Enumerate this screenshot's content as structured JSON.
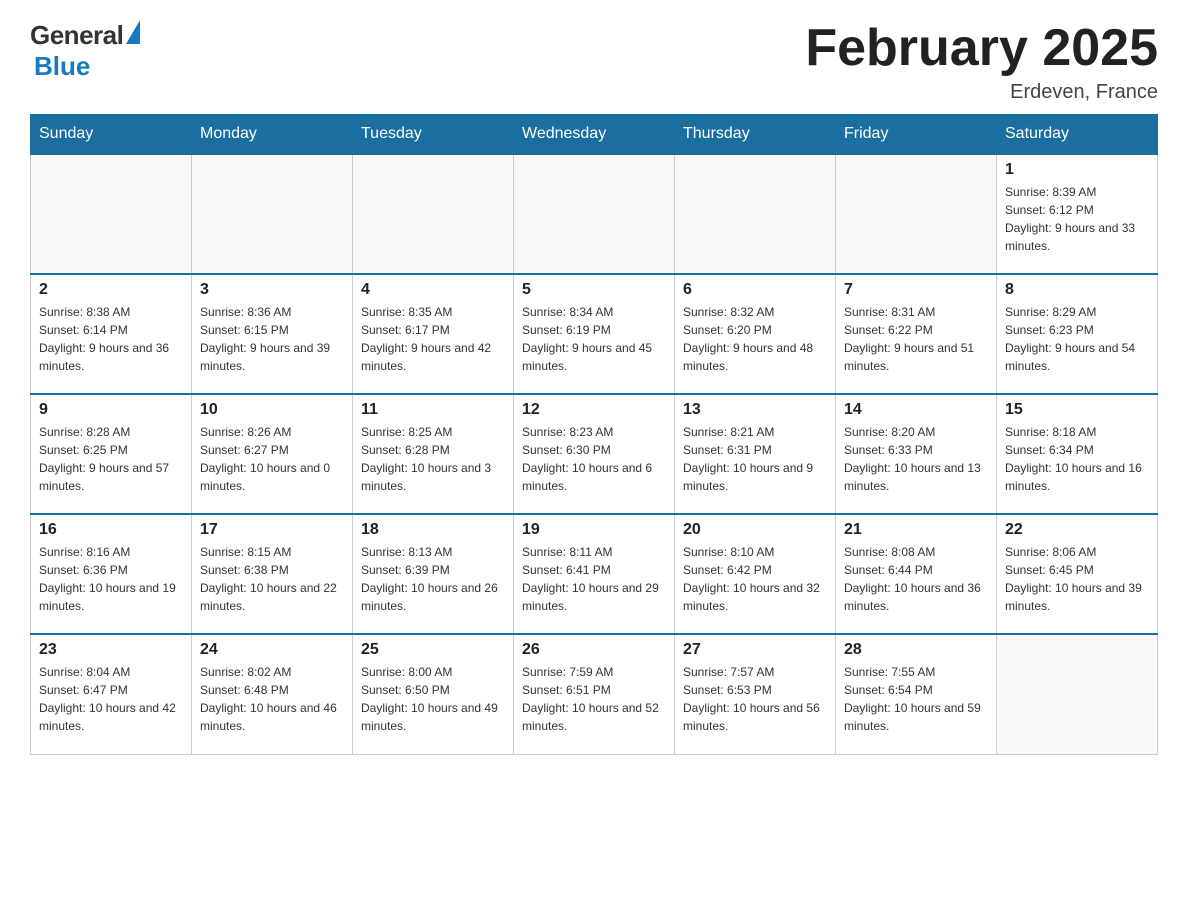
{
  "header": {
    "title": "February 2025",
    "location": "Erdeven, France"
  },
  "logo": {
    "general": "General",
    "blue": "Blue"
  },
  "weekdays": [
    "Sunday",
    "Monday",
    "Tuesday",
    "Wednesday",
    "Thursday",
    "Friday",
    "Saturday"
  ],
  "weeks": [
    [
      {
        "day": "",
        "info": ""
      },
      {
        "day": "",
        "info": ""
      },
      {
        "day": "",
        "info": ""
      },
      {
        "day": "",
        "info": ""
      },
      {
        "day": "",
        "info": ""
      },
      {
        "day": "",
        "info": ""
      },
      {
        "day": "1",
        "info": "Sunrise: 8:39 AM\nSunset: 6:12 PM\nDaylight: 9 hours and 33 minutes."
      }
    ],
    [
      {
        "day": "2",
        "info": "Sunrise: 8:38 AM\nSunset: 6:14 PM\nDaylight: 9 hours and 36 minutes."
      },
      {
        "day": "3",
        "info": "Sunrise: 8:36 AM\nSunset: 6:15 PM\nDaylight: 9 hours and 39 minutes."
      },
      {
        "day": "4",
        "info": "Sunrise: 8:35 AM\nSunset: 6:17 PM\nDaylight: 9 hours and 42 minutes."
      },
      {
        "day": "5",
        "info": "Sunrise: 8:34 AM\nSunset: 6:19 PM\nDaylight: 9 hours and 45 minutes."
      },
      {
        "day": "6",
        "info": "Sunrise: 8:32 AM\nSunset: 6:20 PM\nDaylight: 9 hours and 48 minutes."
      },
      {
        "day": "7",
        "info": "Sunrise: 8:31 AM\nSunset: 6:22 PM\nDaylight: 9 hours and 51 minutes."
      },
      {
        "day": "8",
        "info": "Sunrise: 8:29 AM\nSunset: 6:23 PM\nDaylight: 9 hours and 54 minutes."
      }
    ],
    [
      {
        "day": "9",
        "info": "Sunrise: 8:28 AM\nSunset: 6:25 PM\nDaylight: 9 hours and 57 minutes."
      },
      {
        "day": "10",
        "info": "Sunrise: 8:26 AM\nSunset: 6:27 PM\nDaylight: 10 hours and 0 minutes."
      },
      {
        "day": "11",
        "info": "Sunrise: 8:25 AM\nSunset: 6:28 PM\nDaylight: 10 hours and 3 minutes."
      },
      {
        "day": "12",
        "info": "Sunrise: 8:23 AM\nSunset: 6:30 PM\nDaylight: 10 hours and 6 minutes."
      },
      {
        "day": "13",
        "info": "Sunrise: 8:21 AM\nSunset: 6:31 PM\nDaylight: 10 hours and 9 minutes."
      },
      {
        "day": "14",
        "info": "Sunrise: 8:20 AM\nSunset: 6:33 PM\nDaylight: 10 hours and 13 minutes."
      },
      {
        "day": "15",
        "info": "Sunrise: 8:18 AM\nSunset: 6:34 PM\nDaylight: 10 hours and 16 minutes."
      }
    ],
    [
      {
        "day": "16",
        "info": "Sunrise: 8:16 AM\nSunset: 6:36 PM\nDaylight: 10 hours and 19 minutes."
      },
      {
        "day": "17",
        "info": "Sunrise: 8:15 AM\nSunset: 6:38 PM\nDaylight: 10 hours and 22 minutes."
      },
      {
        "day": "18",
        "info": "Sunrise: 8:13 AM\nSunset: 6:39 PM\nDaylight: 10 hours and 26 minutes."
      },
      {
        "day": "19",
        "info": "Sunrise: 8:11 AM\nSunset: 6:41 PM\nDaylight: 10 hours and 29 minutes."
      },
      {
        "day": "20",
        "info": "Sunrise: 8:10 AM\nSunset: 6:42 PM\nDaylight: 10 hours and 32 minutes."
      },
      {
        "day": "21",
        "info": "Sunrise: 8:08 AM\nSunset: 6:44 PM\nDaylight: 10 hours and 36 minutes."
      },
      {
        "day": "22",
        "info": "Sunrise: 8:06 AM\nSunset: 6:45 PM\nDaylight: 10 hours and 39 minutes."
      }
    ],
    [
      {
        "day": "23",
        "info": "Sunrise: 8:04 AM\nSunset: 6:47 PM\nDaylight: 10 hours and 42 minutes."
      },
      {
        "day": "24",
        "info": "Sunrise: 8:02 AM\nSunset: 6:48 PM\nDaylight: 10 hours and 46 minutes."
      },
      {
        "day": "25",
        "info": "Sunrise: 8:00 AM\nSunset: 6:50 PM\nDaylight: 10 hours and 49 minutes."
      },
      {
        "day": "26",
        "info": "Sunrise: 7:59 AM\nSunset: 6:51 PM\nDaylight: 10 hours and 52 minutes."
      },
      {
        "day": "27",
        "info": "Sunrise: 7:57 AM\nSunset: 6:53 PM\nDaylight: 10 hours and 56 minutes."
      },
      {
        "day": "28",
        "info": "Sunrise: 7:55 AM\nSunset: 6:54 PM\nDaylight: 10 hours and 59 minutes."
      },
      {
        "day": "",
        "info": ""
      }
    ]
  ]
}
